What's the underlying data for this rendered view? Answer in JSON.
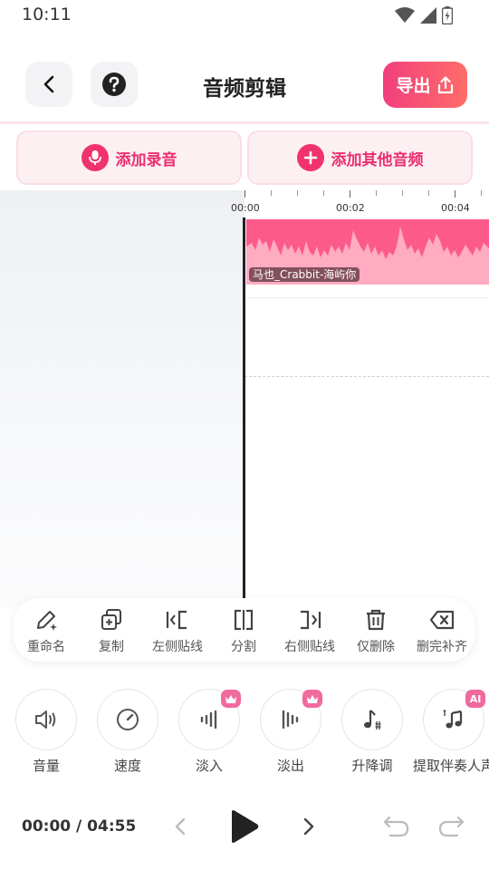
{
  "status": {
    "time": "10:11"
  },
  "header": {
    "title": "音频剪辑",
    "export_label": "导出"
  },
  "add": {
    "record_label": "添加录音",
    "other_label": "添加其他音频"
  },
  "ruler": {
    "labels": [
      "00:00",
      "00:02",
      "00:04"
    ]
  },
  "clip": {
    "name": "马也_Crabbit-海屿你",
    "color": "#fd5a8c"
  },
  "edit_tools": [
    {
      "label": "重命名",
      "icon": "rename-icon"
    },
    {
      "label": "复制",
      "icon": "copy-icon"
    },
    {
      "label": "左侧贴线",
      "icon": "snap-left-icon"
    },
    {
      "label": "分割",
      "icon": "split-icon"
    },
    {
      "label": "右侧贴线",
      "icon": "snap-right-icon"
    },
    {
      "label": "仅删除",
      "icon": "trash-icon"
    },
    {
      "label": "删完补齐",
      "icon": "delete-fill-icon"
    }
  ],
  "effects": [
    {
      "label": "音量",
      "icon": "volume-icon"
    },
    {
      "label": "速度",
      "icon": "speed-icon"
    },
    {
      "label": "淡入",
      "icon": "fade-in-icon",
      "badge": "crown"
    },
    {
      "label": "淡出",
      "icon": "fade-out-icon",
      "badge": "crown"
    },
    {
      "label": "升降调",
      "icon": "pitch-icon"
    },
    {
      "label": "提取伴奏人声",
      "icon": "extract-icon",
      "badge": "AI"
    }
  ],
  "playback": {
    "current": "00:00",
    "total": "04:55",
    "readout": "00:00 / 04:55"
  },
  "colors": {
    "accent": "#f0336f",
    "accent_light": "#fdf0f3"
  }
}
